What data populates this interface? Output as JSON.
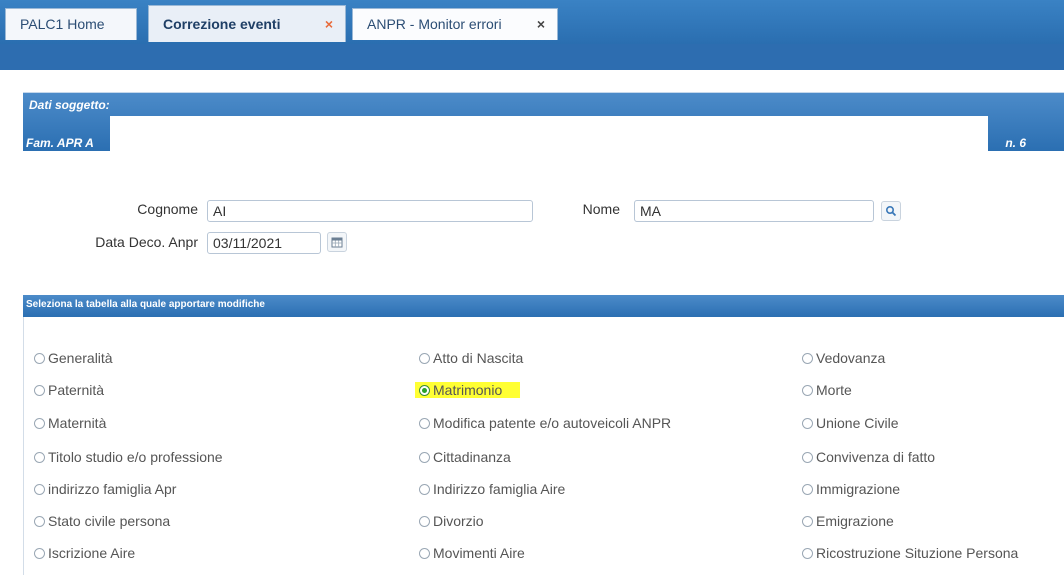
{
  "tabs": [
    {
      "label": "PALC1 Home",
      "close": ""
    },
    {
      "label": "Correzione eventi",
      "close": "×"
    },
    {
      "label": "ANPR - Monitor errori",
      "close": "×"
    }
  ],
  "subject": {
    "title": "Dati soggetto:",
    "row_left": "Fam. APR A",
    "row_right": "n. 6"
  },
  "form": {
    "cognome_label": "Cognome",
    "cognome_value": "AI",
    "nome_label": "Nome",
    "nome_value": "MA",
    "data_label": "Data Deco. Anpr",
    "data_value": "03/11/2021"
  },
  "selection": {
    "title": "Seleziona la tabella alla quale apportare modifiche",
    "col1": [
      "Generalità",
      "Paternità",
      "Maternità",
      "Titolo studio e/o professione",
      "indirizzo famiglia Apr",
      "Stato civile persona",
      "Iscrizione Aire"
    ],
    "col2": [
      "Atto di Nascita",
      "Matrimonio",
      "Modifica patente e/o autoveicoli ANPR",
      "Cittadinanza",
      "Indirizzo famiglia Aire",
      "Divorzio",
      "Movimenti Aire"
    ],
    "col3": [
      "Vedovanza",
      "Morte",
      "Unione Civile",
      "Convivenza di fatto",
      "Immigrazione",
      "Emigrazione",
      "Ricostruzione Situzione Persona"
    ],
    "selected": "Matrimonio",
    "highlight_color": "#ffff33"
  },
  "colors": {
    "accent": "#2d6db0",
    "tab_close_active": "#e86a3a"
  },
  "icons": {
    "search": "search-icon",
    "calendar": "calendar-icon"
  }
}
